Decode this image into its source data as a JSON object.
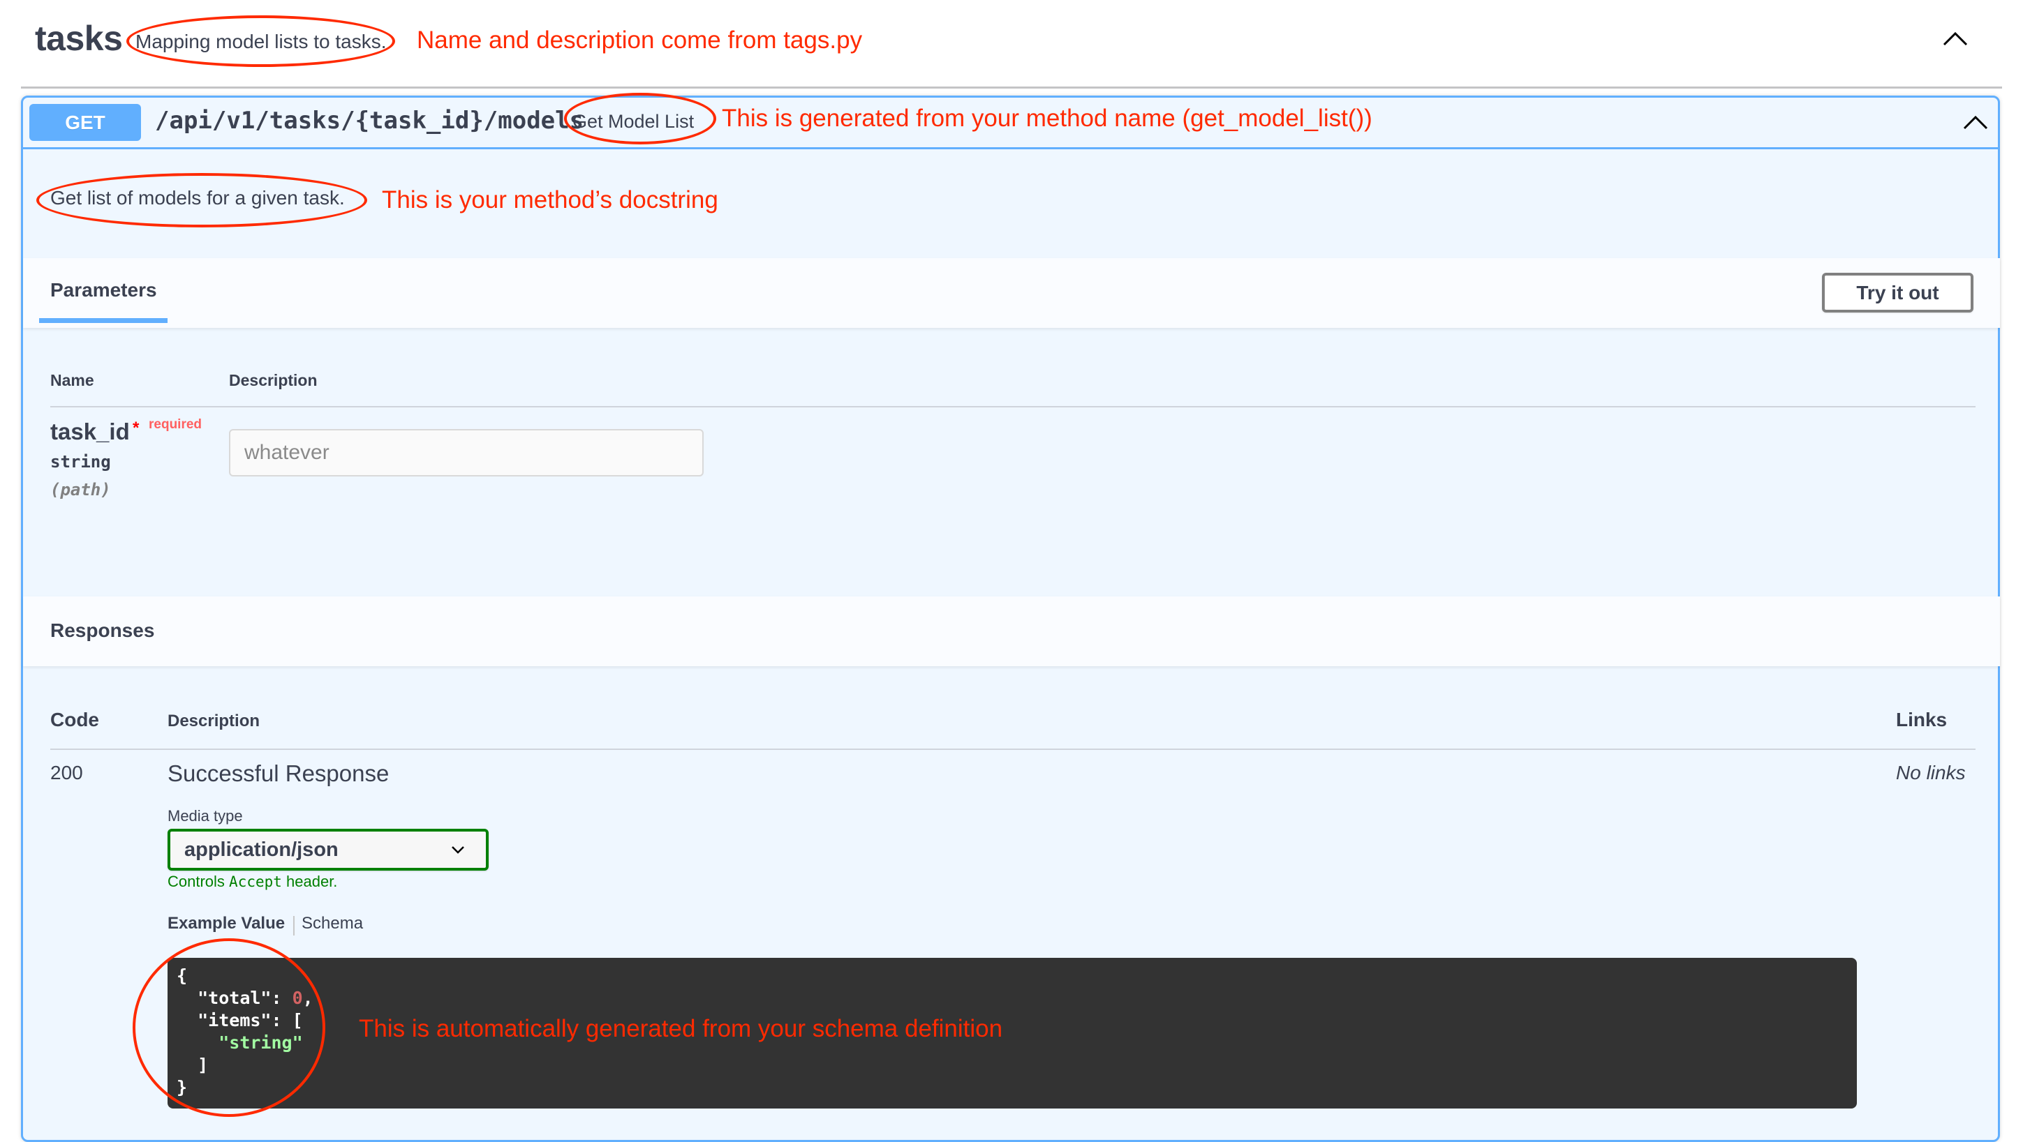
{
  "tag": {
    "name": "tasks",
    "description": "Mapping model lists to tasks."
  },
  "operation": {
    "method": "GET",
    "path": "/api/v1/tasks/{task_id}/models",
    "summary": "Get Model List",
    "description": "Get list of models for a given task.",
    "method_color": "#61affe"
  },
  "parameters": {
    "title": "Parameters",
    "try_it_out_label": "Try it out",
    "columns": {
      "name": "Name",
      "description": "Description"
    },
    "items": [
      {
        "name": "task_id",
        "required_marker": "*",
        "required_label": "required",
        "type": "string",
        "in": "(path)",
        "placeholder": "whatever",
        "value": ""
      }
    ]
  },
  "responses": {
    "title": "Responses",
    "columns": {
      "code": "Code",
      "description": "Description",
      "links": "Links"
    },
    "items": [
      {
        "code": "200",
        "description": "Successful Response",
        "links": "No links",
        "media_type_label": "Media type",
        "media_type": "application/json",
        "controls_prefix": "Controls ",
        "controls_code": "Accept",
        "controls_suffix": " header.",
        "tabs": [
          "Example Value",
          "Schema"
        ],
        "active_tab": "Example Value",
        "example": {
          "open": "{",
          "total_key": "\"total\"",
          "total_value": "0",
          "items_key": "\"items\"",
          "items_open": "[",
          "items_value": "\"string\"",
          "items_close": "]",
          "close": "}"
        }
      }
    ]
  },
  "annotations": {
    "tag": "Name and description come from tags.py",
    "summary": "This is generated from your method name (get_model_list())",
    "docstring": "This is your method’s docstring",
    "schema": "This is automatically generated from your schema definition",
    "color": "#ff2a00"
  }
}
